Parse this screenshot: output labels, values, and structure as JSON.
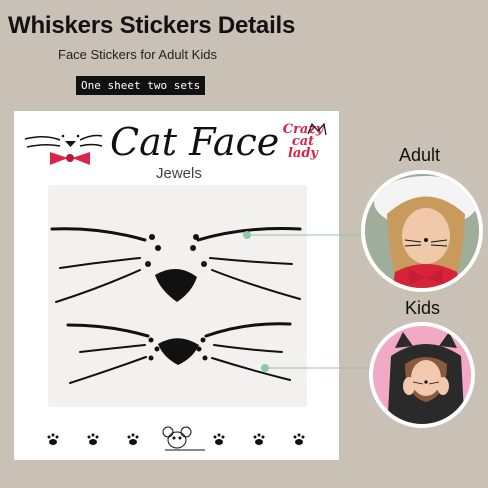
{
  "header": {
    "title": "Whiskers Stickers Details",
    "subtitle": "Face Stickers for Adult Kids",
    "tag": "One sheet two sets"
  },
  "product": {
    "brand_name": "Cat Face",
    "brand_sub": "Jewels",
    "badge_lines": [
      "Crazy",
      "cat",
      "lady"
    ]
  },
  "callouts": {
    "adult_label": "Adult",
    "kids_label": "Kids"
  },
  "colors": {
    "background": "#c9c1b5",
    "accent_red": "#d9254a",
    "callout_line": "#8fc7a3"
  }
}
